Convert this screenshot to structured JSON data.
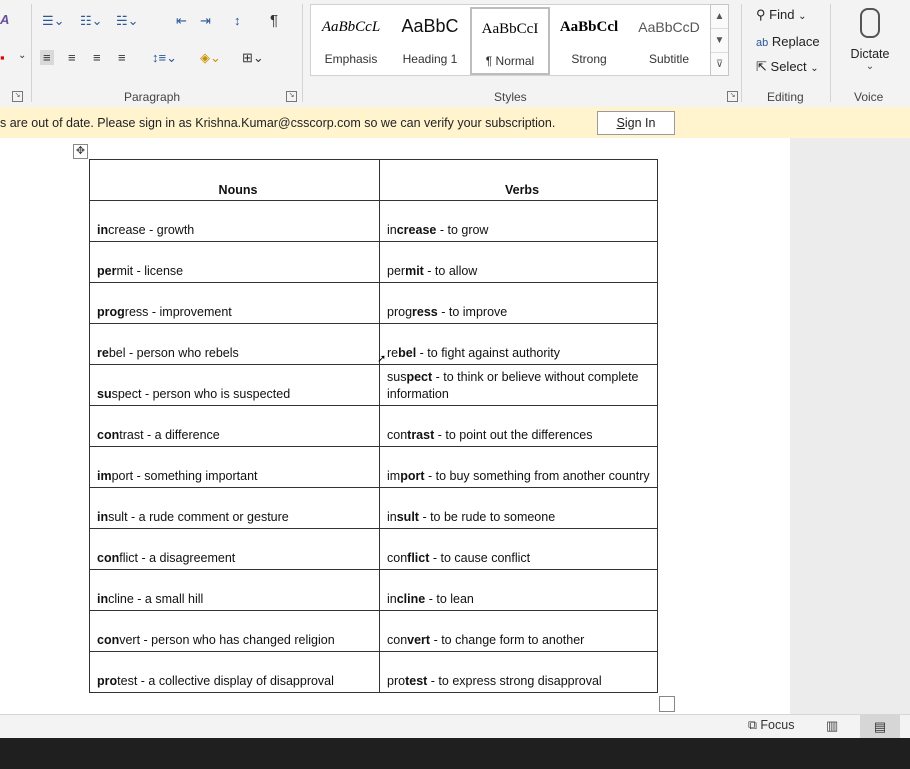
{
  "ribbon": {
    "paragraph_label": "Paragraph",
    "styles_label": "Styles",
    "editing_label": "Editing",
    "voice_label": "Voice",
    "styles": [
      {
        "preview": "AaBbCcL",
        "name": "Emphasis"
      },
      {
        "preview": "AaBbC",
        "name": "Heading 1"
      },
      {
        "preview": "AaBbCcI",
        "name": "¶ Normal"
      },
      {
        "preview": "AaBbCcl",
        "name": "Strong"
      },
      {
        "preview": "AaBbCcD",
        "name": "Subtitle"
      }
    ],
    "find_label": "Find",
    "replace_label": "Replace",
    "select_label": "Select",
    "dictate_label": "Dictate"
  },
  "message_bar": {
    "text": "s are out of date. Please sign in as Krishna.Kumar@csscorp.com so we can verify your subscription.",
    "button_underlined": "S",
    "button_rest": "ign In"
  },
  "table": {
    "headers": [
      "Nouns",
      "Verbs"
    ],
    "rows": [
      {
        "noun": [
          "in",
          "crease - growth"
        ],
        "verb": [
          "in",
          "crease",
          " - to grow"
        ]
      },
      {
        "noun": [
          "per",
          "mit - license"
        ],
        "verb": [
          "per",
          "mit",
          " - to allow"
        ]
      },
      {
        "noun": [
          "prog",
          "ress - improvement"
        ],
        "verb": [
          "prog",
          "ress",
          " - to improve"
        ]
      },
      {
        "noun": [
          "re",
          "bel - person who rebels"
        ],
        "verb": [
          "re",
          "bel",
          " - to fight against authority"
        ]
      },
      {
        "noun": [
          "su",
          "spect - person who is suspected"
        ],
        "verb": [
          "sus",
          "pect",
          " - to think or believe without complete information"
        ]
      },
      {
        "noun": [
          "con",
          "trast - a difference"
        ],
        "verb": [
          "con",
          "trast",
          " - to point out the differences"
        ]
      },
      {
        "noun": [
          "im",
          "port - something important"
        ],
        "verb": [
          "im",
          "port",
          " - to buy something from another country"
        ]
      },
      {
        "noun": [
          "in",
          "sult - a rude comment or gesture"
        ],
        "verb": [
          "in",
          "sult",
          " - to be rude to someone"
        ]
      },
      {
        "noun": [
          "con",
          "flict - a disagreement"
        ],
        "verb": [
          "con",
          "flict",
          " - to cause conflict"
        ]
      },
      {
        "noun": [
          "in",
          "cline - a small hill"
        ],
        "verb": [
          "in",
          "cline",
          " - to lean"
        ]
      },
      {
        "noun": [
          "con",
          "vert - person who has changed religion"
        ],
        "verb": [
          "con",
          "vert",
          " - to change form to another"
        ]
      },
      {
        "noun": [
          "pro",
          "test - a collective display of disapproval"
        ],
        "verb": [
          "pro",
          "test",
          " - to express strong disapproval"
        ]
      }
    ]
  },
  "status_bar": {
    "focus_label": "Focus"
  }
}
